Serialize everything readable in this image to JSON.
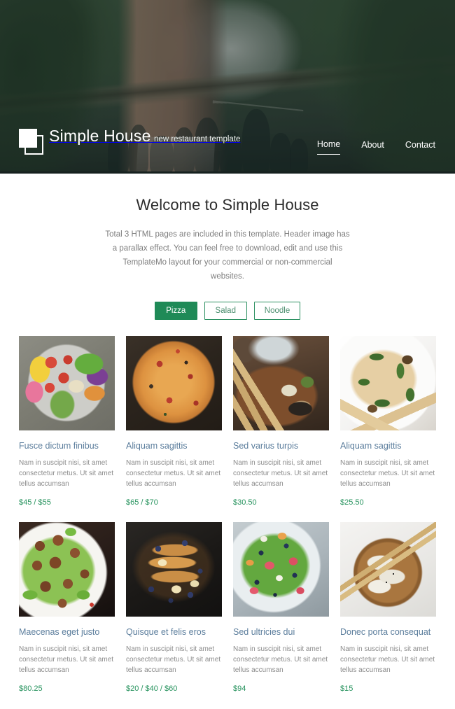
{
  "header": {
    "brand_name": "Simple House",
    "brand_tagline": "new restaurant template",
    "nav": [
      {
        "label": "Home",
        "active": true
      },
      {
        "label": "About",
        "active": false
      },
      {
        "label": "Contact",
        "active": false
      }
    ]
  },
  "welcome": {
    "title": "Welcome to Simple House",
    "description": "Total 3 HTML pages are included in this template. Header image has a parallax effect. You can feel free to download, edit and use this TemplateMo layout for your commercial or non-commercial websites."
  },
  "filters": [
    {
      "label": "Pizza",
      "active": true
    },
    {
      "label": "Salad",
      "active": false
    },
    {
      "label": "Noodle",
      "active": false
    }
  ],
  "menu_items": [
    {
      "title": "Fusce dictum finibus",
      "description": "Nam in suscipit nisi, sit amet consectetur metus. Ut sit amet tellus accumsan",
      "price": "$45 / $55",
      "image": "salad-bowl-photo"
    },
    {
      "title": "Aliquam sagittis",
      "description": "Nam in suscipit nisi, sit amet consectetur metus. Ut sit amet tellus accumsan",
      "price": "$65 / $70",
      "image": "pizza-photo"
    },
    {
      "title": "Sed varius turpis",
      "description": "Nam in suscipit nisi, sit amet consectetur metus. Ut sit amet tellus accumsan",
      "price": "$30.50",
      "image": "grilled-bread-photo"
    },
    {
      "title": "Aliquam sagittis",
      "description": "Nam in suscipit nisi, sit amet consectetur metus. Ut sit amet tellus accumsan",
      "price": "$25.50",
      "image": "pasta-photo"
    },
    {
      "title": "Maecenas eget justo",
      "description": "Nam in suscipit nisi, sit amet consectetur metus. Ut sit amet tellus accumsan",
      "price": "$80.25",
      "image": "meatballs-photo"
    },
    {
      "title": "Quisque et felis eros",
      "description": "Nam in suscipit nisi, sit amet consectetur metus. Ut sit amet tellus accumsan",
      "price": "$20 / $40 / $60",
      "image": "french-toast-photo"
    },
    {
      "title": "Sed ultricies dui",
      "description": "Nam in suscipit nisi, sit amet consectetur metus. Ut sit amet tellus accumsan",
      "price": "$94",
      "image": "berry-salad-photo"
    },
    {
      "title": "Donec porta consequat",
      "description": "Nam in suscipit nisi, sit amet consectetur metus. Ut sit amet tellus accumsan",
      "price": "$15",
      "image": "dumplings-photo"
    }
  ],
  "colors": {
    "accent_green": "#1f8a57",
    "price_green": "#27935e",
    "title_blue": "#5b7d9c",
    "body_gray": "#8b8b8b",
    "heading_dark": "#2b2b2b"
  }
}
